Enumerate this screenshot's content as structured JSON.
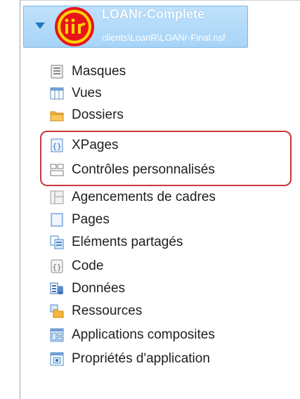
{
  "header": {
    "app_name": "LOANr-Complete",
    "app_path": "clients\\LoanR\\LOANr-Final.nsf"
  },
  "items": [
    {
      "label": "Masques",
      "icon": "form-icon"
    },
    {
      "label": "Vues",
      "icon": "view-icon"
    },
    {
      "label": "Dossiers",
      "icon": "folder-icon"
    },
    {
      "label": "XPages",
      "icon": "xpage-icon"
    },
    {
      "label": "Contrôles personnalisés",
      "icon": "custom-control-icon"
    },
    {
      "label": "Agencements de cadres",
      "icon": "frameset-icon"
    },
    {
      "label": "Pages",
      "icon": "page-icon"
    },
    {
      "label": "Eléments partagés",
      "icon": "shared-elements-icon"
    },
    {
      "label": "Code",
      "icon": "code-icon"
    },
    {
      "label": "Données",
      "icon": "data-icon"
    },
    {
      "label": "Ressources",
      "icon": "resources-icon"
    },
    {
      "label": "Applications composites",
      "icon": "composite-apps-icon"
    },
    {
      "label": "Propriétés d'application",
      "icon": "app-properties-icon"
    }
  ],
  "colors": {
    "highlight": "#c8383d",
    "header_bg": "#a7d4f7",
    "logo_red": "#e8141b",
    "logo_yellow": "#ffd200"
  }
}
